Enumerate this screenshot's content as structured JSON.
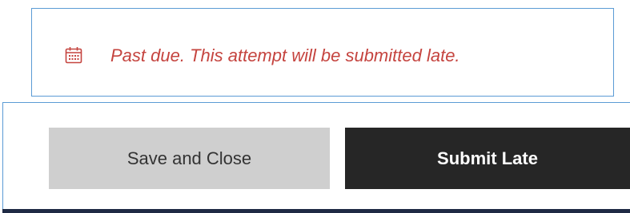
{
  "notice": {
    "icon": "calendar-icon",
    "message": "Past due. This attempt will be submitted late.",
    "color": "#c5443f"
  },
  "actions": {
    "save_label": "Save and Close",
    "submit_label": "Submit Late"
  }
}
